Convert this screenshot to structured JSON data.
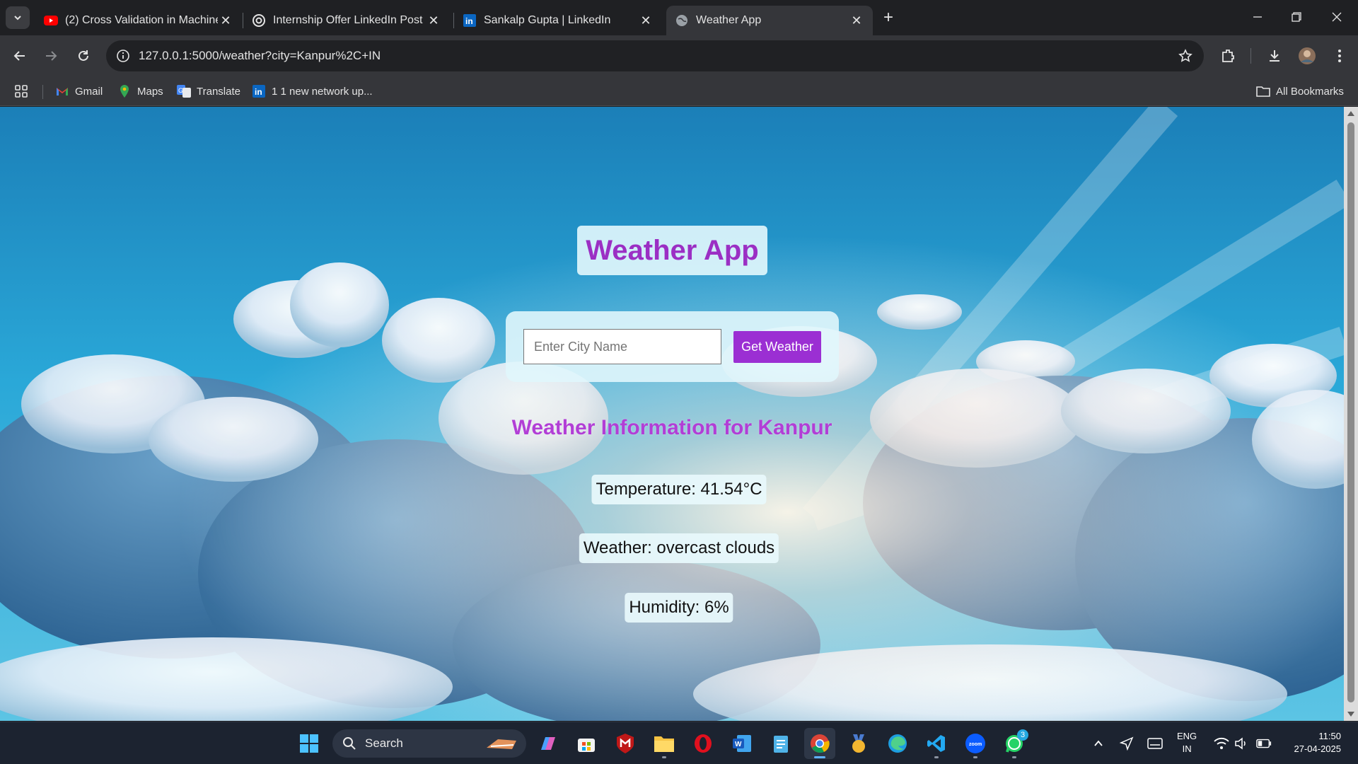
{
  "browser": {
    "tabs": [
      {
        "title": "(2) Cross Validation in Machine",
        "icon": "youtube-icon",
        "active": false
      },
      {
        "title": "Internship Offer LinkedIn Post",
        "icon": "openai-icon",
        "active": false
      },
      {
        "title": "Sankalp Gupta | LinkedIn",
        "icon": "linkedin-icon",
        "active": false
      },
      {
        "title": "Weather App",
        "icon": "globe-icon",
        "active": true
      }
    ],
    "url": "127.0.0.1:5000/weather?city=Kanpur%2C+IN",
    "bookmarks": [
      {
        "label": "Gmail",
        "icon": "gmail-icon"
      },
      {
        "label": "Maps",
        "icon": "maps-icon"
      },
      {
        "label": "Translate",
        "icon": "translate-icon"
      },
      {
        "label": "1 1 new network up...",
        "icon": "linkedin-icon"
      }
    ],
    "all_bookmarks_label": "All Bookmarks"
  },
  "page": {
    "title": "Weather App",
    "search": {
      "placeholder": "Enter City Name",
      "value": "",
      "button_label": "Get Weather"
    },
    "result": {
      "heading": "Weather Information for Kanpur",
      "temperature": "Temperature: 41.54°C",
      "weather": "Weather: overcast clouds",
      "humidity": "Humidity: 6%"
    },
    "colors": {
      "accent": "#9b2fd3",
      "title": "#9b2fc4",
      "heading": "#b23ed6"
    }
  },
  "taskbar": {
    "search_label": "Search",
    "language": "ENG",
    "region": "IN",
    "time": "11:50",
    "date": "27-04-2025",
    "whatsapp_badge": "3"
  }
}
